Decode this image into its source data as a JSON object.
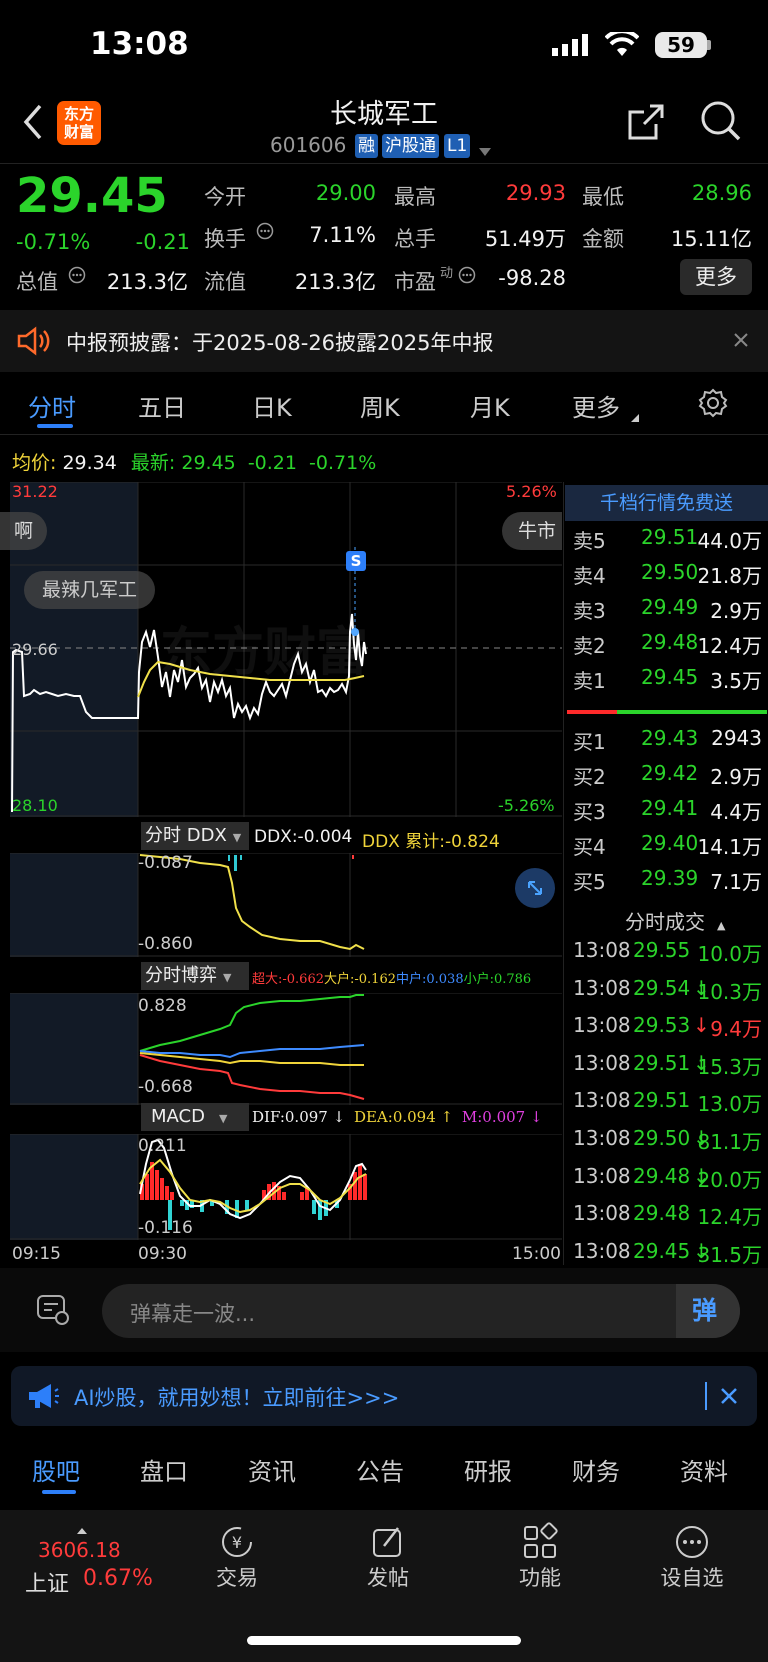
{
  "status": {
    "time": "13:08",
    "battery": "59"
  },
  "header": {
    "logo_line1": "东方",
    "logo_line2": "财富",
    "name": "长城军工",
    "code": "601606",
    "tags": [
      "融",
      "沪股通",
      "L1"
    ]
  },
  "quote": {
    "price": "29.45",
    "change_pct": "-0.71%",
    "change": "-0.21",
    "open_label": "今开",
    "open": "29.00",
    "high_label": "最高",
    "high": "29.93",
    "low_label": "最低",
    "low": "28.96",
    "turnover_label": "换手",
    "turnover": "7.11%",
    "volume_label": "总手",
    "volume": "51.49万",
    "amount_label": "金额",
    "amount": "15.11亿",
    "mktcap_label": "总值",
    "mktcap": "213.3亿",
    "float_label": "流值",
    "float": "213.3亿",
    "pe_label": "市盈",
    "pe_sup": "动",
    "pe": "-98.28",
    "more": "更多"
  },
  "notice": {
    "text": "中报预披露：于2025-08-26披露2025年中报"
  },
  "tabs": [
    "分时",
    "五日",
    "日K",
    "周K",
    "月K",
    "更多"
  ],
  "chart_info": {
    "avg_label": "均价:",
    "avg": "29.34",
    "last_label": "最新:",
    "last": "29.45",
    "chg": "-0.21",
    "chg_pct": "-0.71%",
    "top_price": "31.22",
    "top_pct": "5.26%",
    "mid_price": "29.66",
    "bot_price": "28.10",
    "bot_pct": "-5.26%",
    "chip_left": "啊",
    "chip_right": "牛市",
    "chip_topic": "最辣几军工",
    "watermark": "东方财富",
    "sell_marker": "S"
  },
  "ddx": {
    "select": "分时 DDX",
    "ddx_text": "DDX:-0.004",
    "cum_text": "DDX 累计:-0.824",
    "top_label": "-0.087",
    "bot_label": "-0.860"
  },
  "game": {
    "select": "分时博弈",
    "super": "超大:-0.662",
    "large": "大户:-0.162",
    "mid": "中户:0.038",
    "small": "小户:0.786",
    "top_label": "0.828",
    "bot_label": "-0.668"
  },
  "macd": {
    "select": "MACD",
    "dif": "DIF:0.097 ↓",
    "dea": "DEA:0.094 ↑",
    "m": "M:0.007 ↓",
    "top_label": "0.211",
    "bot_label": "-0.116"
  },
  "time_axis": [
    "09:15",
    "09:30",
    "15:00"
  ],
  "orderbook": {
    "promo": "千档行情免费送",
    "sells": [
      {
        "label": "卖5",
        "price": "29.51",
        "vol": "44.0万"
      },
      {
        "label": "卖4",
        "price": "29.50",
        "vol": "21.8万"
      },
      {
        "label": "卖3",
        "price": "29.49",
        "vol": "2.9万"
      },
      {
        "label": "卖2",
        "price": "29.48",
        "vol": "12.4万"
      },
      {
        "label": "卖1",
        "price": "29.45",
        "vol": "3.5万"
      }
    ],
    "buys": [
      {
        "label": "买1",
        "price": "29.43",
        "vol": "2943"
      },
      {
        "label": "买2",
        "price": "29.42",
        "vol": "2.9万"
      },
      {
        "label": "买3",
        "price": "29.41",
        "vol": "4.4万"
      },
      {
        "label": "买4",
        "price": "29.40",
        "vol": "14.1万"
      },
      {
        "label": "买5",
        "price": "29.39",
        "vol": "7.1万"
      }
    ],
    "trades_title": "分时成交",
    "trades": [
      {
        "time": "13:08",
        "price": "29.55",
        "vol": "10.0万",
        "arrow": "",
        "color": "#2bd42b"
      },
      {
        "time": "13:08",
        "price": "29.54",
        "vol": "10.3万",
        "arrow": "↓",
        "color": "#2bd42b"
      },
      {
        "time": "13:08",
        "price": "29.53",
        "vol": "9.4万",
        "arrow": "↓",
        "color": "#ff3b3b"
      },
      {
        "time": "13:08",
        "price": "29.51",
        "vol": "15.3万",
        "arrow": "↓",
        "color": "#2bd42b"
      },
      {
        "time": "13:08",
        "price": "29.51",
        "vol": "13.0万",
        "arrow": "",
        "color": "#2bd42b"
      },
      {
        "time": "13:08",
        "price": "29.50",
        "vol": "81.1万",
        "arrow": "↓",
        "color": "#2bd42b"
      },
      {
        "time": "13:08",
        "price": "29.48",
        "vol": "20.0万",
        "arrow": "↓",
        "color": "#2bd42b"
      },
      {
        "time": "13:08",
        "price": "29.48",
        "vol": "12.4万",
        "arrow": "",
        "color": "#2bd42b"
      },
      {
        "time": "13:08",
        "price": "29.45",
        "vol": "31.5万",
        "arrow": "↓",
        "color": "#2bd42b"
      }
    ]
  },
  "comment": {
    "placeholder": "弹幕走一波...",
    "danmu": "弹"
  },
  "ai_bar": {
    "text": "AI炒股，就用妙想！立即前往>>>"
  },
  "bottom_tabs": [
    "股吧",
    "盘口",
    "资讯",
    "公告",
    "研报",
    "财务",
    "资料"
  ],
  "index": {
    "value": "3606.18",
    "name": "上证",
    "pct": "0.67%"
  },
  "nav": [
    "交易",
    "发帖",
    "功能",
    "设自选"
  ],
  "colors": {
    "up": "#ff3b3b",
    "down": "#2bd42b",
    "accent": "#2d7ff9",
    "avg_line": "#f0e04a"
  }
}
